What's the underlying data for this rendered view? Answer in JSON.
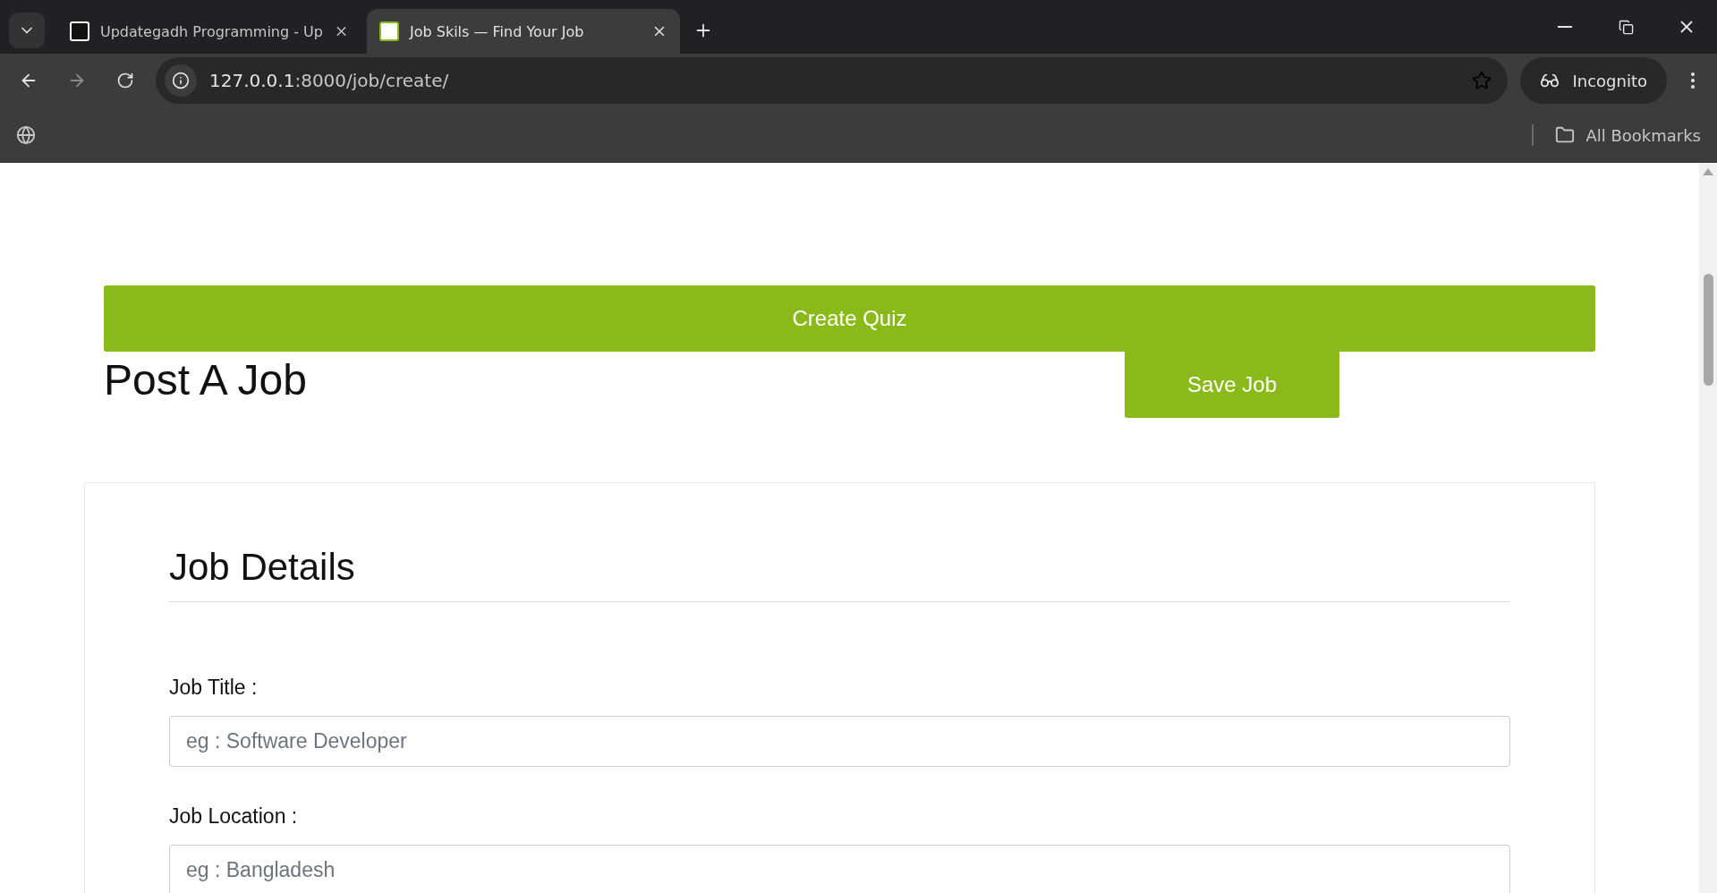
{
  "browser": {
    "tabs": [
      {
        "title": "Updategadh Programming - Up",
        "selected": false
      },
      {
        "title": "Job Skils — Find Your Job",
        "selected": true
      }
    ],
    "address": {
      "host": "127.0.0.1",
      "path": ":8000/job/create/"
    },
    "profile": "Incognito",
    "bookmarks": "All Bookmarks"
  },
  "page": {
    "create_quiz": "Create Quiz",
    "heading": "Post A Job",
    "save_job": "Save Job",
    "section": {
      "title": "Job Details",
      "fields": [
        {
          "label": "Job Title :",
          "placeholder": "eg : Software Developer"
        },
        {
          "label": "Job Location :",
          "placeholder": "eg : Bangladesh"
        }
      ]
    }
  }
}
